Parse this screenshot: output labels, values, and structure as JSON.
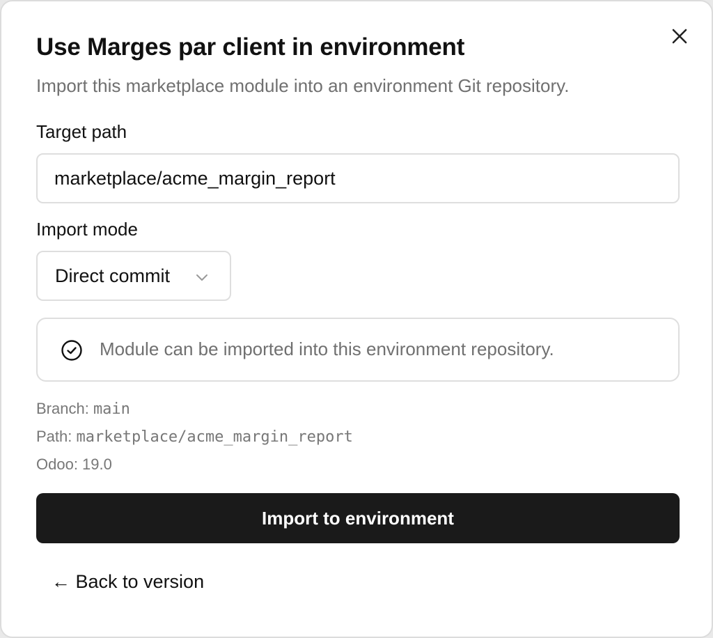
{
  "dialog": {
    "title": "Use Marges par client in environment",
    "subtitle": "Import this marketplace module into an environment Git repository."
  },
  "form": {
    "target_path_label": "Target path",
    "target_path_value": "marketplace/acme_margin_report",
    "import_mode_label": "Import mode",
    "import_mode_value": "Direct commit"
  },
  "status": {
    "icon": "check-circle-icon",
    "message": "Module can be imported into this environment repository."
  },
  "meta": {
    "branch_label": "Branch: ",
    "branch_value": "main",
    "path_label": "Path: ",
    "path_value": "marketplace/acme_margin_report",
    "odoo_label": "Odoo: ",
    "odoo_value": "19.0"
  },
  "actions": {
    "import_label": "Import to environment",
    "back_label": "← Back to version"
  },
  "icons": {
    "close": "close-icon",
    "chevron": "chevron-down-icon"
  },
  "colors": {
    "primary_button": "#1a1a1a",
    "muted_text": "#707070",
    "border": "#dedede"
  }
}
